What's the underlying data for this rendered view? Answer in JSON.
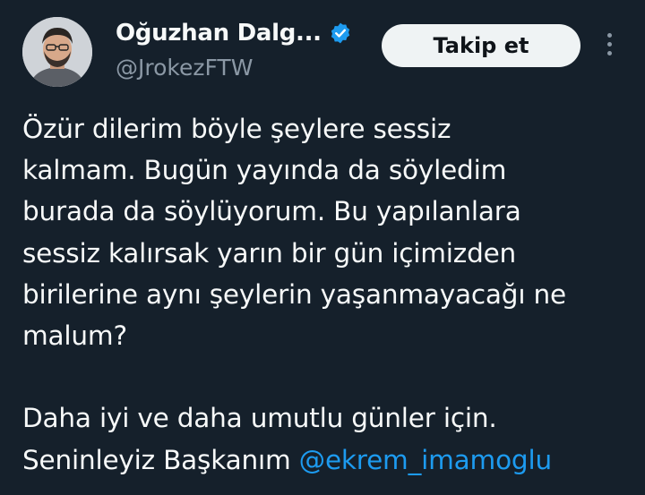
{
  "author": {
    "display_name": "Oğuzhan Dalg...",
    "handle": "@JrokezFTW",
    "verified": true,
    "avatar_icon": "profile-photo"
  },
  "actions": {
    "follow_label": "Takip et",
    "more_icon": "more-vertical-icon"
  },
  "tweet": {
    "lines": [
      "Özür dilerim böyle şeylere sessiz",
      "kalmam. Bugün yayında da söyledim",
      "burada da söylüyorum. Bu yapılanlara",
      "sessiz kalırsak yarın bir gün içimizden",
      "birilerine aynı şeylerin yaşanmayacağı ne",
      "malum?"
    ],
    "line_7": "Daha iyi ve daha umutlu günler için.",
    "line_8_prefix": "Seninleyiz Başkanım",
    "mention": "@ekrem_imamoglu"
  },
  "colors": {
    "background": "#15202b",
    "text": "#f7f9f9",
    "secondary_text": "#8b98a5",
    "accent": "#1d9bf0",
    "button_bg": "#eff3f4"
  }
}
